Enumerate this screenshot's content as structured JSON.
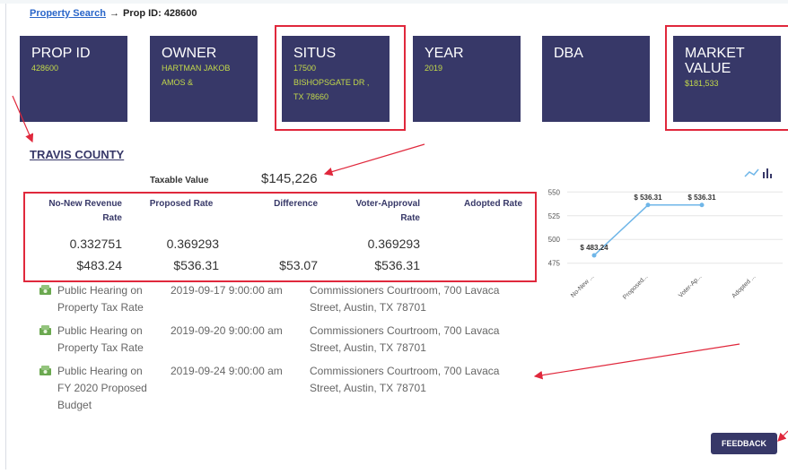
{
  "breadcrumb": {
    "link": "Property Search",
    "arrow": "→",
    "current": "Prop ID: 428600"
  },
  "cards": [
    {
      "label": "PROP ID",
      "lines": [
        "428600"
      ]
    },
    {
      "label": "OWNER",
      "lines": [
        "HARTMAN JAKOB",
        "AMOS &"
      ]
    },
    {
      "label": "SITUS",
      "lines": [
        "17500",
        "BISHOPSGATE DR ,",
        "TX 78660"
      ]
    },
    {
      "label": "YEAR",
      "lines": [
        "2019"
      ]
    },
    {
      "label": "DBA",
      "lines": []
    },
    {
      "label": "MARKET",
      "label2": "VALUE",
      "lines": [
        "$181,533"
      ]
    }
  ],
  "county": {
    "name": "TRAVIS COUNTY",
    "taxable_label": "Taxable Value",
    "taxable_value": "$145,226"
  },
  "rates": {
    "headers": [
      [
        "No-New Revenue",
        "Rate"
      ],
      [
        "Proposed Rate"
      ],
      [
        "Difference"
      ],
      [
        "Voter-Approval",
        "Rate"
      ],
      [
        "Adopted Rate"
      ]
    ],
    "row1": [
      "0.332751",
      "0.369293",
      "",
      "0.369293",
      ""
    ],
    "row2": [
      "$483.24",
      "$536.31",
      "$53.07",
      "$536.31",
      ""
    ]
  },
  "events": [
    {
      "title": [
        "Public Hearing on",
        "Property Tax Rate"
      ],
      "date": "2019-09-17 9:00:00 am",
      "loc": [
        "Commissioners Courtroom, 700 Lavaca",
        "Street, Austin, TX 78701"
      ]
    },
    {
      "title": [
        "Public Hearing on",
        "Property Tax Rate"
      ],
      "date": "2019-09-20 9:00:00 am",
      "loc": [
        "Commissioners Courtroom, 700 Lavaca",
        "Street, Austin, TX 78701"
      ]
    },
    {
      "title": [
        "Public Hearing on",
        "FY 2020 Proposed",
        "Budget"
      ],
      "date": "2019-09-24 9:00:00 am",
      "loc": [
        "Commissioners Courtroom, 700 Lavaca",
        "Street, Austin, TX 78701"
      ]
    }
  ],
  "chart_data": {
    "type": "line",
    "categories": [
      "No-New ...",
      "Proposed...",
      "Voter-Ap...",
      "Adopted ..."
    ],
    "values": [
      483.24,
      536.31,
      536.31,
      null
    ],
    "data_labels": [
      "$ 483.24",
      "$ 536.31",
      "$ 536.31",
      ""
    ],
    "yticks": [
      475,
      500,
      525,
      550
    ],
    "ylim": [
      470,
      555
    ],
    "line_color": "#6fb6e8",
    "grid": true
  },
  "toolbar_icons": [
    "line-chart-icon",
    "bar-chart-icon"
  ],
  "feedback": {
    "label": "FEEDBACK"
  },
  "colors": {
    "card_bg": "#373868",
    "card_value": "#c3d94a",
    "highlight": "#e0283c",
    "link": "#2a66c9"
  }
}
